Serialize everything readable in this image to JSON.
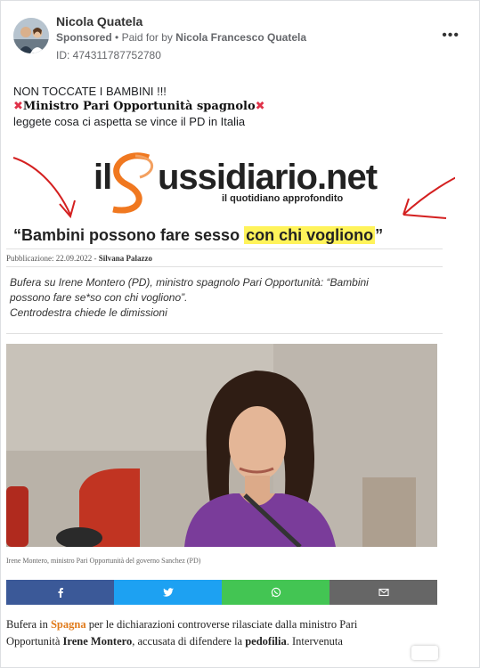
{
  "post": {
    "author": "Nicola Quatela",
    "sponsored_label": "Sponsored",
    "dot": "•",
    "paid_for_prefix": "Paid for by",
    "paid_for_name": "Nicola Francesco Quatela",
    "ad_id": "ID: 474311787752780",
    "more_icon": "•••",
    "text_line1": "NON TOCCATE I BAMBINI !!!",
    "text_line2_mark_left": "✖",
    "text_line2": "Ministro Pari Opportunità spagnolo",
    "text_line2_mark_right": "✖",
    "text_line3": "leggete cosa ci aspetta se vince il PD in Italia"
  },
  "shared_image": {
    "logo_part1": "il",
    "logo_part2": "ussidiario.net",
    "logo_tagline": "il quotidiano approfondito",
    "headline_pre": "“Bambini possono fare sesso ",
    "headline_highlight": "con chi vogliono",
    "headline_post": "”",
    "pub_label": "Pubblicazione: 22.09.2022 - ",
    "pub_author": "Silvana Palazzo",
    "summary_line1": "Bufera su Irene Montero (PD), ministro spagnolo Pari Opportunità: “Bambini",
    "summary_line2": "possono fare se*so con chi vogliono”.",
    "summary_line3": "Centrodestra chiede le dimissioni",
    "caption": "Irene Montero, ministro Pari Opportunità del governo Sanchez (PD)",
    "share_buttons": [
      {
        "name": "facebook",
        "color": "#3b5998"
      },
      {
        "name": "twitter",
        "color": "#1da1f2"
      },
      {
        "name": "whatsapp",
        "color": "#43c553"
      },
      {
        "name": "email",
        "color": "#666666"
      }
    ],
    "body_p1": "Bufera in ",
    "body_spagna": "Spagna",
    "body_p2": " per le dichiarazioni controverse rilasciate dalla ministro Pari",
    "body_p3": "Opportunità ",
    "body_name": "Irene Montero",
    "body_p4": ", accusata di difendere la ",
    "body_pedofilia": "pedofilia",
    "body_p5": ". Intervenuta"
  }
}
